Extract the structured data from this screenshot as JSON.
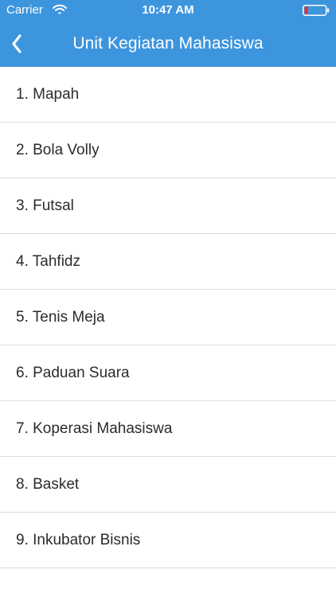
{
  "status_bar": {
    "carrier": "Carrier",
    "time": "10:47 AM",
    "battery_color": "#e0312f",
    "icons": [
      "wifi-icon",
      "battery-icon"
    ]
  },
  "nav": {
    "title": "Unit Kegiatan Mahasiswa",
    "back_icon": "chevron-left-icon",
    "background_color": "#3d95de"
  },
  "list": {
    "items": [
      "1. Mapah",
      "2. Bola Volly",
      "3. Futsal",
      "4. Tahfidz",
      "5. Tenis Meja",
      "6. Paduan Suara",
      "7. Koperasi Mahasiswa",
      "8. Basket",
      "9. Inkubator Bisnis"
    ]
  }
}
